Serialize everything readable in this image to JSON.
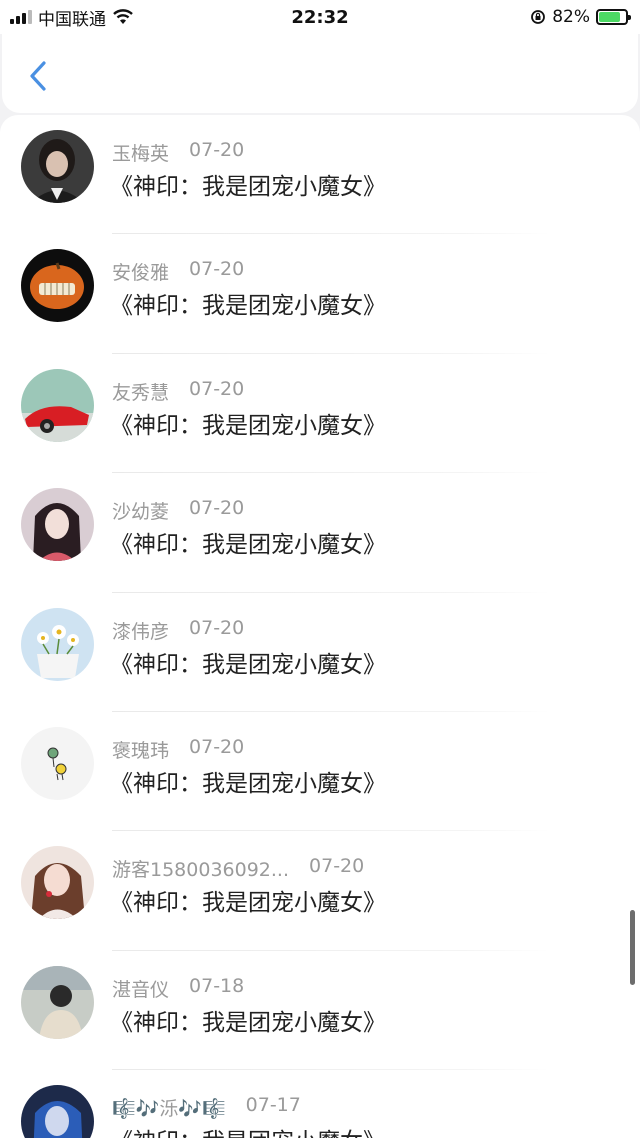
{
  "status_bar": {
    "carrier": "中国联通",
    "time": "22:32",
    "battery_percent": "82%",
    "battery_level": 0.82
  },
  "items": [
    {
      "name": "玉梅英",
      "date": "07-20",
      "title": "《神印：我是团宠小魔女》"
    },
    {
      "name": "安俊雅",
      "date": "07-20",
      "title": "《神印：我是团宠小魔女》"
    },
    {
      "name": "友秀慧",
      "date": "07-20",
      "title": "《神印：我是团宠小魔女》"
    },
    {
      "name": "沙幼菱",
      "date": "07-20",
      "title": "《神印：我是团宠小魔女》"
    },
    {
      "name": "漆伟彦",
      "date": "07-20",
      "title": "《神印：我是团宠小魔女》"
    },
    {
      "name": "褒瑰玮",
      "date": "07-20",
      "title": "《神印：我是团宠小魔女》"
    },
    {
      "name": "游客1580036092...",
      "date": "07-20",
      "title": "《神印：我是团宠小魔女》"
    },
    {
      "name": "湛音仪",
      "date": "07-18",
      "title": "《神印：我是团宠小魔女》"
    },
    {
      "name": "🎼🎶泺🎶🎼",
      "date": "07-17",
      "title": "《神印：我是团宠小魔女》"
    }
  ],
  "colors": {
    "accent": "#4a90e2",
    "meta_text": "#9a9a9a",
    "title_text": "#222222"
  }
}
